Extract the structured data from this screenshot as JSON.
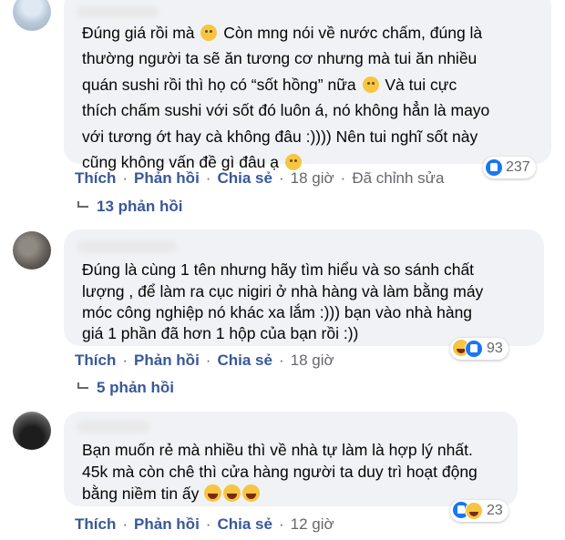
{
  "comments": [
    {
      "lines": [
        "Đúng giá rồi mà ",
        "thường người ta sẽ ăn tương cơ nhưng mà tui ăn nhiều",
        "quán sushi rồi thì họ có “sốt hồng” nữa ",
        "thích chấm sushi với sốt đó luôn á, nó không hẳn là mayo",
        "với tương ớt hay cà không đâu :)))) Nên tui nghĩ sốt này",
        "cũng không vấn đề gì đâu ạ "
      ],
      "line1_tail": " Còn mng nói về nước chấm, đúng là",
      "line3_tail": " Và tui cực",
      "reaction_count": "237",
      "actions": {
        "like": "Thích",
        "reply": "Phản hồi",
        "share": "Chia sẻ",
        "time": "18 giờ",
        "edited": "Đã chỉnh sửa"
      },
      "replies": "13 phản hồi"
    },
    {
      "lines": [
        "Đúng là cùng 1 tên nhưng hãy tìm hiểu và so sánh chất",
        "lượng , để làm ra cục nigiri ở nhà hàng và làm bằng máy",
        "móc công nghiệp nó khác xa lắm :))) bạn vào nhà hàng",
        "giá 1 phần đã hơn 1 hộp của bạn rồi :))"
      ],
      "reaction_count": "93",
      "actions": {
        "like": "Thích",
        "reply": "Phản hồi",
        "share": "Chia sẻ",
        "time": "18 giờ"
      },
      "replies": "5 phản hồi"
    },
    {
      "lines": [
        "Bạn muốn rẻ mà nhiều thì về nhà tự làm là hợp lý nhất.",
        "45k mà còn chê thì cửa hàng người ta duy trì hoạt động",
        "bằng niềm tin ấy "
      ],
      "reaction_count": "23",
      "actions": {
        "like": "Thích",
        "reply": "Phản hồi",
        "share": "Chia sẻ",
        "time": "12 giờ"
      }
    }
  ],
  "colors": {
    "link": "#385898",
    "meta": "#65676b",
    "bubble": "#f0f2f5",
    "like": "#1877f2"
  },
  "icons": [
    "smile-emoji",
    "like-reaction",
    "haha-reaction",
    "reply-arrow-icon"
  ]
}
